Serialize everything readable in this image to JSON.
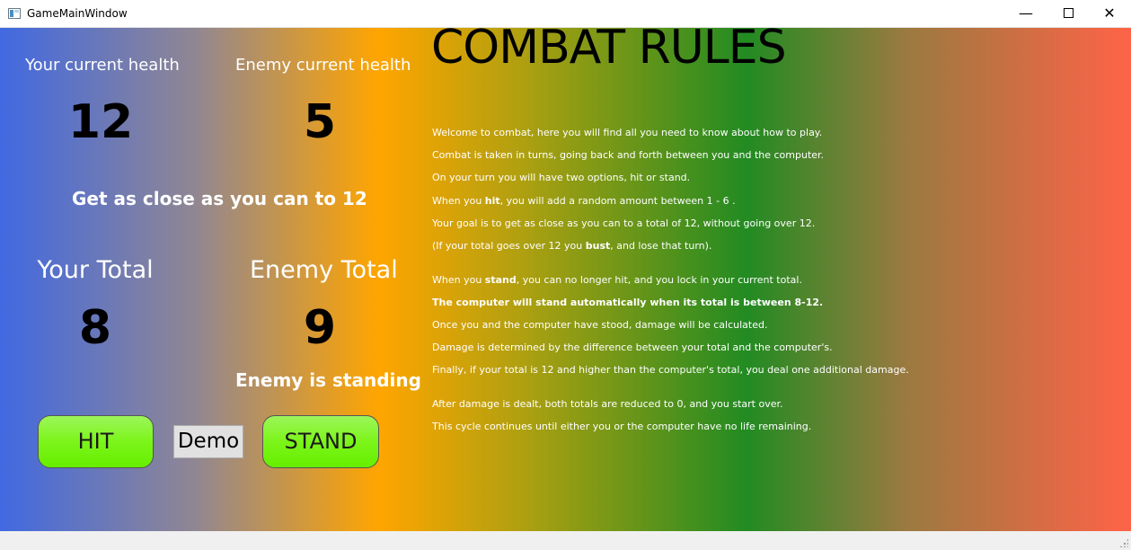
{
  "window": {
    "title": "GameMainWindow",
    "minimize_glyph": "—",
    "close_glyph": "✕"
  },
  "stats": {
    "player_health_label": "Your current health",
    "player_health": "12",
    "enemy_health_label": "Enemy current health",
    "enemy_health": "5",
    "goal_message": "Get as close as you can to 12",
    "player_total_label": "Your Total",
    "player_total": "8",
    "enemy_total_label": "Enemy Total",
    "enemy_total": "9",
    "enemy_status": "Enemy is standing"
  },
  "buttons": {
    "hit": "HIT",
    "demo": "Demo",
    "stand": "STAND"
  },
  "rules": {
    "title": "COMBAT RULES",
    "line1": "Welcome to combat, here you will find all you need to know about how to play.",
    "line2": "Combat is taken in turns, going back and forth between you and the computer.",
    "line3": "On your turn you will have two options, hit or stand.",
    "line4_pre": "When you ",
    "line4_bold": "hit",
    "line4_post": ", you will add a random amount between 1 - 6 .",
    "line5": "Your goal is to get as close as you can to a total of 12, without going over 12.",
    "line6_pre": "(If your total goes over 12 you ",
    "line6_bold": "bust",
    "line6_post": ", and lose that turn).",
    "line7_pre": "When you ",
    "line7_bold": "stand",
    "line7_post": ", you can no longer hit, and you lock in your current total.",
    "line8": "The computer will stand automatically when its total is between 8-12.",
    "line9": "Once you and the computer have stood, damage will be calculated.",
    "line10": "Damage is determined by the difference between your total and the computer's.",
    "line11": "Finally, if your total is 12 and higher than the computer's total, you deal one additional damage.",
    "line12": "After damage is dealt, both totals are reduced to 0, and you start over.",
    "line13": "This cycle continues until either you or the computer have no life remaining."
  },
  "colors": {
    "gradient_stops": [
      "#4169e1",
      "#8f8694",
      "#ffa500",
      "#b0a010",
      "#228b22",
      "#9a7a40",
      "#ff6347"
    ],
    "button_green": "#7cf51a"
  }
}
